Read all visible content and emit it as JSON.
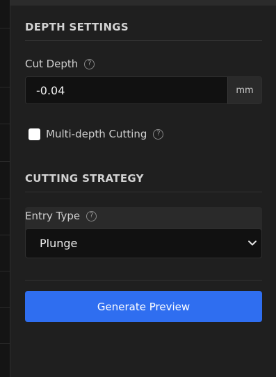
{
  "depth_settings": {
    "title": "DEPTH SETTINGS",
    "cut_depth": {
      "label": "Cut Depth",
      "help_glyph": "?",
      "value": "-0.04",
      "unit": "mm"
    },
    "multi_depth": {
      "label": "Multi-depth Cutting",
      "checked": false,
      "help_glyph": "?"
    }
  },
  "cutting_strategy": {
    "title": "CUTTING STRATEGY",
    "entry_type": {
      "label": "Entry Type",
      "help_glyph": "?",
      "selected": "Plunge"
    }
  },
  "actions": {
    "generate_label": "Generate Preview"
  },
  "colors": {
    "accent": "#2f6ef0",
    "panel_bg": "#1f1f1f",
    "input_bg": "#111111"
  }
}
